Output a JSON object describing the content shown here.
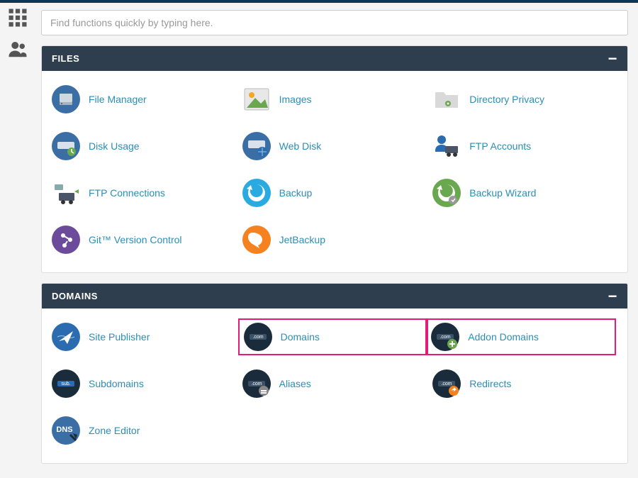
{
  "search": {
    "placeholder": "Find functions quickly by typing here."
  },
  "panels": {
    "files": {
      "title": "FILES",
      "items": [
        "File Manager",
        "Images",
        "Directory Privacy",
        "Disk Usage",
        "Web Disk",
        "FTP Accounts",
        "FTP Connections",
        "Backup",
        "Backup Wizard",
        "Git™ Version Control",
        "JetBackup"
      ]
    },
    "domains": {
      "title": "DOMAINS",
      "items": [
        "Site Publisher",
        "Domains",
        "Addon Domains",
        "Subdomains",
        "Aliases",
        "Redirects",
        "Zone Editor"
      ]
    }
  }
}
